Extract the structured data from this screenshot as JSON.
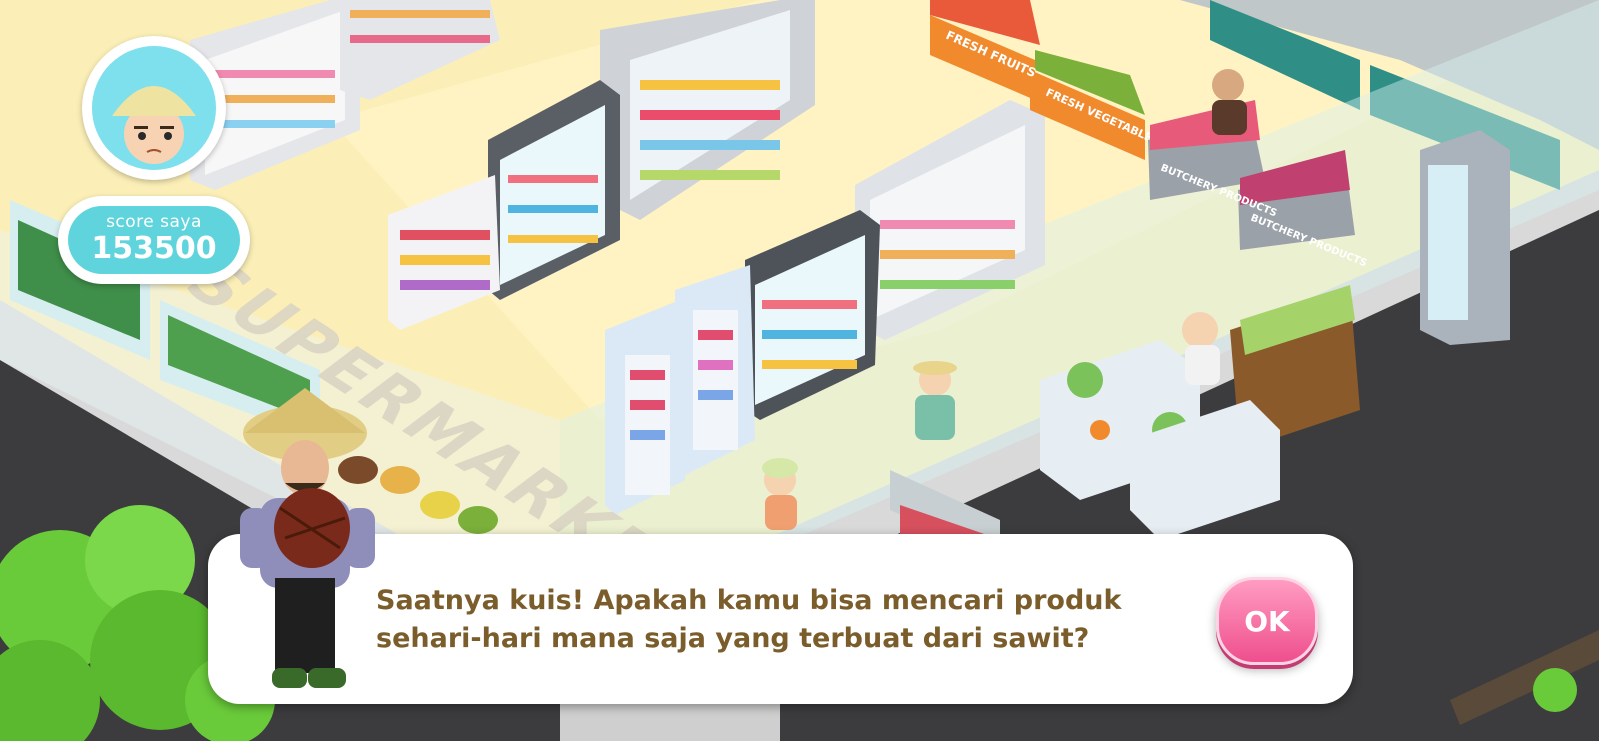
{
  "game": {
    "storefront_text": "SUPERMARKET",
    "signs": {
      "fresh_fruits": "FRESH FRUITS",
      "fresh_vegetables": "FRESH VEGETABLES",
      "butchery_1": "BUTCHERY PRODUCTS",
      "butchery_2": "BUTCHERY PRODUCTS"
    }
  },
  "hud": {
    "score_label": "score saya",
    "score_value": "153500"
  },
  "dialog": {
    "line1": "Saatnya kuis! Apakah kamu bisa mencari produk",
    "line2": "sehari-hari mana saja yang terbuat dari sawit?",
    "ok_label": "OK"
  },
  "colors": {
    "floor": "#fbefb7",
    "dialog_text": "#7a5d2b",
    "score_bg": "#5fd4dc",
    "ok_button": "#ef4f8d",
    "produce_sign": "#f08a2c"
  },
  "icons": {
    "avatar": "farmer-avatar-icon",
    "character": "farmer-with-palm-fruit"
  }
}
